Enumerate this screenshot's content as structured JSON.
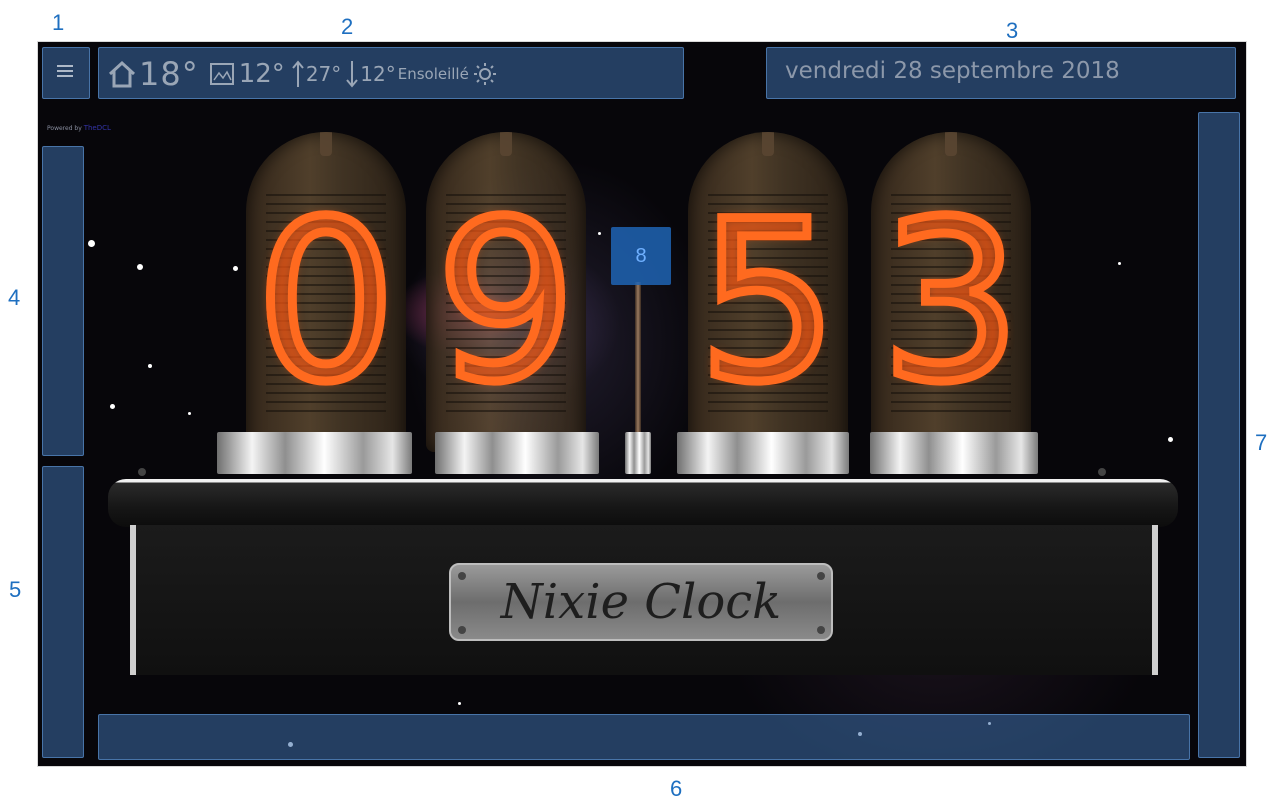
{
  "callouts": [
    "1",
    "2",
    "3",
    "4",
    "5",
    "6",
    "7",
    "8"
  ],
  "header": {
    "indoor_temp": "18°",
    "outdoor_temp": "12°",
    "max_temp": "27°",
    "min_temp": "12°",
    "condition": "Ensoleillé",
    "date": "vendredi 28 septembre 2018"
  },
  "powered_by": {
    "prefix": "Powered by",
    "brand": "TheDCL"
  },
  "clock": {
    "digits": [
      "0",
      "9",
      "5",
      "3"
    ],
    "nameplate": "Nixie Clock"
  },
  "colors": {
    "nixie_glow": "#ff6a1f",
    "zone_overlay": "#3c6eaa",
    "callout_text": "#1e6fc0"
  },
  "icons": [
    "menu-icon",
    "home-icon",
    "outdoor-thermometer-icon",
    "max-temp-arrow-icon",
    "min-temp-arrow-icon",
    "sun-icon"
  ]
}
